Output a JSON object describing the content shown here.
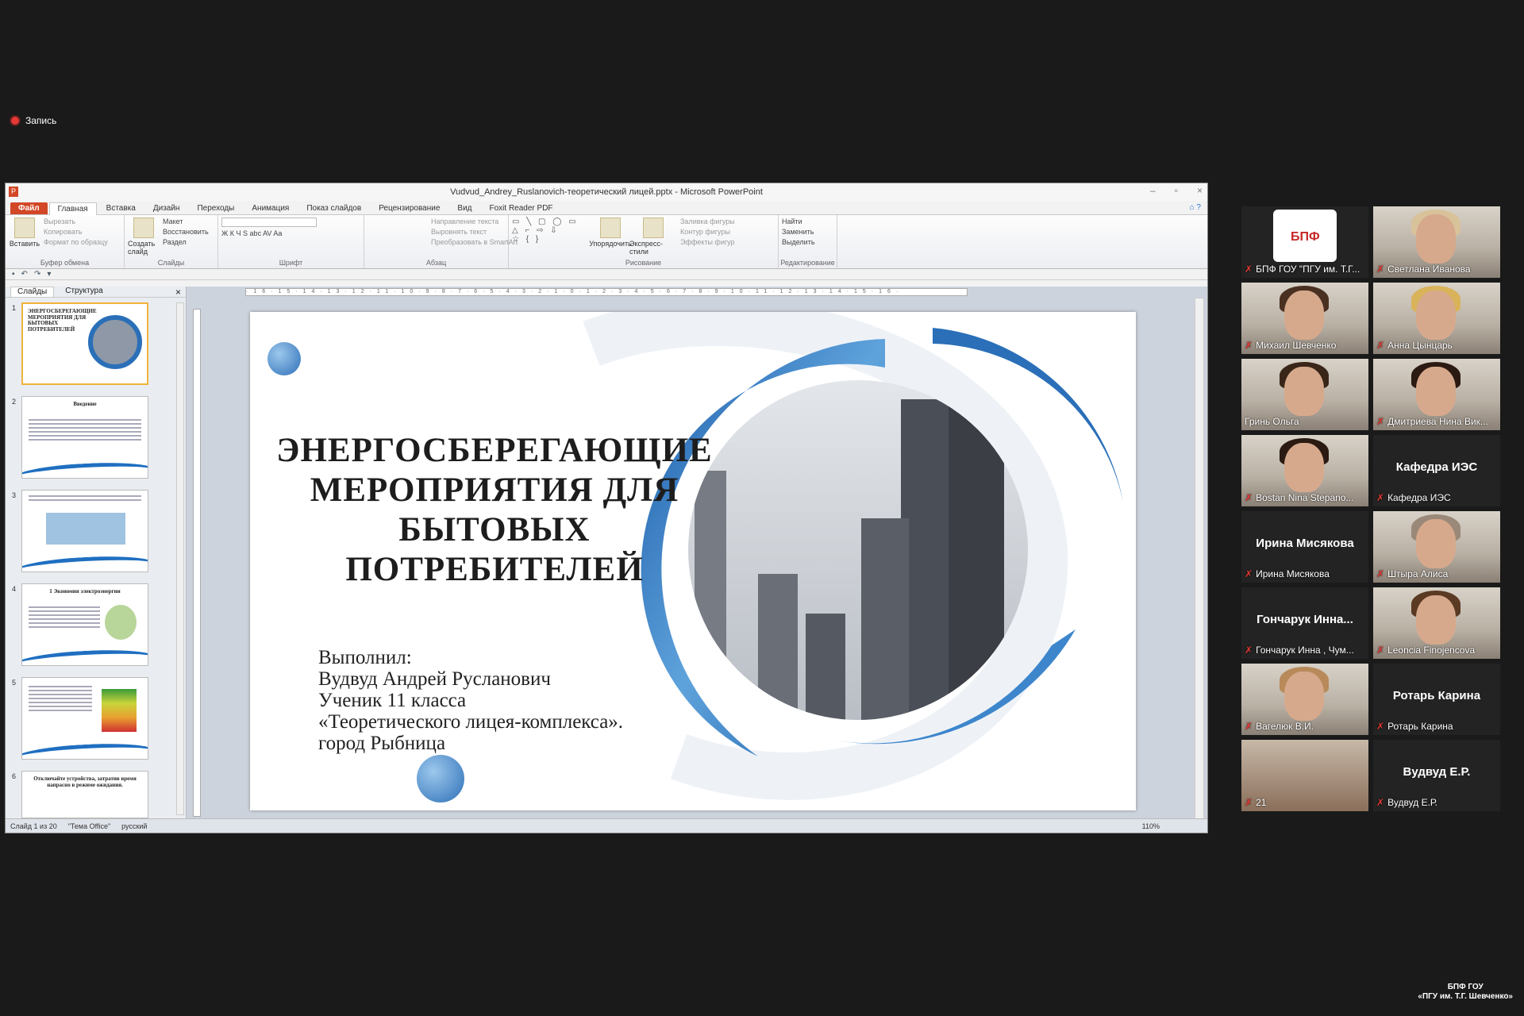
{
  "recording": {
    "label": "Запись"
  },
  "window": {
    "title": "Vudvud_Andrey_Ruslanovich-теоретический лицей.pptx - Microsoft PowerPoint",
    "file_icon": "P"
  },
  "tabs": [
    "Файл",
    "Главная",
    "Вставка",
    "Дизайн",
    "Переходы",
    "Анимация",
    "Показ слайдов",
    "Рецензирование",
    "Вид",
    "Foxit Reader PDF"
  ],
  "ribbon": {
    "clipboard": {
      "paste": "Вставить",
      "cut": "Вырезать",
      "copy": "Копировать",
      "format": "Формат по образцу",
      "label": "Буфер обмена"
    },
    "slides": {
      "new": "Создать слайд",
      "layout": "Макет",
      "reset": "Восстановить",
      "section": "Раздел",
      "label": "Слайды"
    },
    "font": {
      "label": "Шрифт",
      "buttons": "Ж  К  Ч  S  abc  AV  Aa"
    },
    "paragraph": {
      "direction": "Направление текста",
      "align": "Выровнять текст",
      "smartart": "Преобразовать в SmartArt",
      "label": "Абзац"
    },
    "drawing": {
      "arrange": "Упорядочить",
      "styles": "Экспресс-стили",
      "fill": "Заливка фигуры",
      "outline": "Контур фигуры",
      "effects": "Эффекты фигур",
      "label": "Рисование"
    },
    "editing": {
      "find": "Найти",
      "replace": "Заменить",
      "select": "Выделить",
      "label": "Редактирование"
    }
  },
  "panel": {
    "tab_slides": "Слайды",
    "tab_outline": "Структура",
    "close": "×"
  },
  "thumbnails": [
    {
      "n": "1",
      "title": "ЭНЕРГОСБЕРЕГАЮЩИЕ МЕРОПРИЯТИЯ ДЛЯ БЫТОВЫХ ПОТРЕБИТЕЛЕЙ"
    },
    {
      "n": "2",
      "title": "Введение"
    },
    {
      "n": "3",
      "title": ""
    },
    {
      "n": "4",
      "title": "1 Экономия электроэнергии"
    },
    {
      "n": "5",
      "title": ""
    },
    {
      "n": "6",
      "title": "Отключайте устройства, затратив время напрасно в режиме ожидания."
    }
  ],
  "ruler": "·16·15·14·13·12·11·10·9·8·7·6·5·4·3·2·1·0·1·2·3·4·5·6·7·8·9·10·11·12·13·14·15·16·",
  "slide": {
    "title": "ЭНЕРГОСБЕРЕГАЮЩИЕ МЕРОПРИЯТИЯ ДЛЯ БЫТОВЫХ ПОТРЕБИТЕЛЕЙ",
    "author_lines": [
      "Выполнил:",
      "Вудвуд Андрей Русланович",
      "Ученик 11 класса",
      "«Теоретического  лицея-комплекса».",
      "город Рыбница"
    ]
  },
  "status": {
    "slide": "Слайд 1 из 20",
    "theme": "\"Тема Office\"",
    "lang": "русский",
    "zoom": "110%"
  },
  "participants": [
    {
      "name": "БПФ ГОУ \"ПГУ им. Т.Г...",
      "type": "logo",
      "logo_text": "БПФ"
    },
    {
      "name": "Светлана Иванова",
      "type": "video"
    },
    {
      "name": "Михаил Шевченко",
      "type": "video"
    },
    {
      "name": "Анна Цынцарь",
      "type": "video"
    },
    {
      "name": "Гринь Ольга",
      "type": "video"
    },
    {
      "name": "Дмитриева Нина Вик...",
      "type": "video"
    },
    {
      "name": "Bostan Nina Stepano...",
      "type": "video"
    },
    {
      "name": "Кафедра ИЭС",
      "type": "name",
      "big": "Кафедра ИЭС"
    },
    {
      "name": "Ирина Мисякова",
      "type": "name",
      "big": "Ирина Мисякова"
    },
    {
      "name": "Штыра Алиса",
      "type": "video"
    },
    {
      "name": "Гончарук Инна , Чум...",
      "type": "name",
      "big": "Гончарук  Инна..."
    },
    {
      "name": "Leoncia Finojencova",
      "type": "video"
    },
    {
      "name": "Вагелюк В.И.",
      "type": "video"
    },
    {
      "name": "Ротарь Карина",
      "type": "name",
      "big": "Ротарь Карина"
    },
    {
      "name": "21",
      "type": "video"
    },
    {
      "name": "Вудвуд Е.Р.",
      "type": "name",
      "big": "Вудвуд Е.Р."
    }
  ],
  "watermark": {
    "line1": "БПФ ГОУ",
    "line2": "«ПГУ им. Т.Г. Шевченко»"
  },
  "colors": {
    "accent": "#1f6fc1",
    "file_tab": "#d24726",
    "muted": "#e53935"
  }
}
